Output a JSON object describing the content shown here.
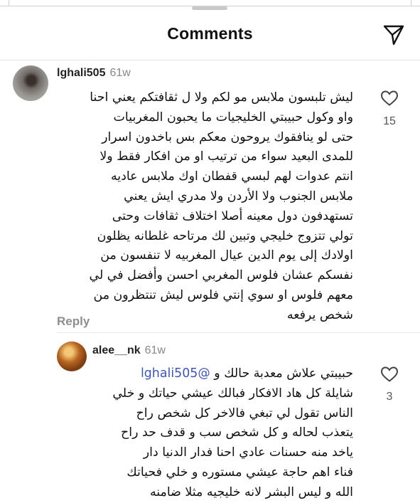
{
  "header": {
    "title": "Comments"
  },
  "comments": [
    {
      "username": "lghali505",
      "time": "61w",
      "lines": [
        "ليش تلبسون ملابس مو لكم ولا ل ثقافتكم يعني احنا",
        "واو وكول حبيبتي الخليجيات ما يحبون المغربيات",
        "حتى لو ينافقوك يروحون معكم بس باخدون اسرار",
        "للمدى البعيد سواء من ترتيب او من افكار فقط ولا",
        "انتم عدوات لهم لبسي قفطان اوك ملابس عاديه",
        "ملابس الجنوب ولا الأردن ولا مدري ايش يعني",
        "تستهدفون دول معينه أصلا اختلاف ثقافات وحتى",
        "تولي تتزوج خليجي وتبين لك مرتاحه غلطانه يظلون",
        "اولادك إلى يوم الدين عيال المغربيه لا تنفسون من",
        "نفسكم عشان فلوس المغربي احسن وأفضل في لي",
        "معهم فلوس او سوي إنتي فلوس ليش تنتظرون من",
        "شخص يرفعه"
      ],
      "reply_label": "Reply",
      "likes": "15"
    },
    {
      "username": "alee__nk",
      "time": "61w",
      "first_line": "حبيبتي علاش معدبة حالك و",
      "mention": "@lghali505",
      "lines": [
        "شايلة كل هاد الافكار فبالك عيشي حياتك و خلي",
        "الناس تقول لي تبغي فالاخر كل شخص راح",
        "يتعذب لحاله و كل شخص سب و قدف حد راح",
        "ياخد منه حسنات  عادي احنا فدار الدنيا دار",
        "فناء اهم حاجة عيشي مستوره و خلي فحياتك",
        "الله و ليس البشر لانه خليجيه مثلا ضامنه"
      ],
      "likes": "3"
    }
  ],
  "icons": {
    "share": "paper-plane-icon",
    "like": "heart-outline-icon"
  },
  "colors": {
    "mention": "#3d55c3",
    "muted": "#8e8e8e"
  }
}
